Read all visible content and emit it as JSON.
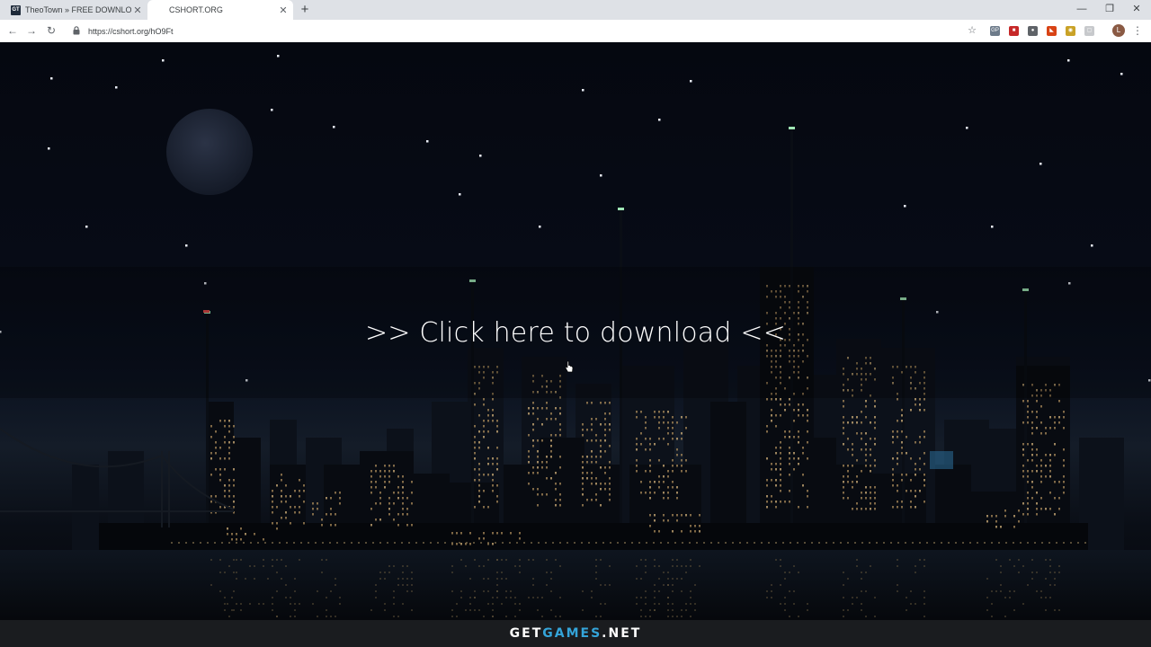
{
  "browser": {
    "tabs": [
      {
        "title": "TheoTown » FREE DOWNLOAD |",
        "favicon": "GT",
        "active": false
      },
      {
        "title": "CSHORT.ORG",
        "active": true
      }
    ],
    "new_tab_label": "+",
    "window_buttons": [
      "—",
      "❐",
      "✕"
    ],
    "nav": {
      "back": "←",
      "forward": "→",
      "reload": "↻"
    },
    "address": {
      "url": "https://cshort.org/hO9Ft",
      "lock_icon": "lock-icon"
    },
    "star": "☆",
    "extensions": [
      {
        "name": "ext-icon-1",
        "color": "#6d7b8a",
        "glyph": "GP"
      },
      {
        "name": "ext-icon-2",
        "color": "#c62828",
        "glyph": "■"
      },
      {
        "name": "ext-icon-3",
        "color": "#5f6368",
        "glyph": "●"
      },
      {
        "name": "ext-icon-4",
        "color": "#d84315",
        "glyph": "◣"
      },
      {
        "name": "ext-icon-5",
        "color": "#c9a227",
        "glyph": "◉"
      },
      {
        "name": "ext-icon-6",
        "color": "#c7c9cc",
        "glyph": "▢"
      }
    ],
    "avatar_letter": "L",
    "menu": "⋮"
  },
  "page": {
    "download_text": ">> Click here to download <<"
  },
  "watermark": {
    "part1": "GET",
    "part2": "GAMES",
    "part3": ".NET",
    "accent": "#34a4d9"
  }
}
